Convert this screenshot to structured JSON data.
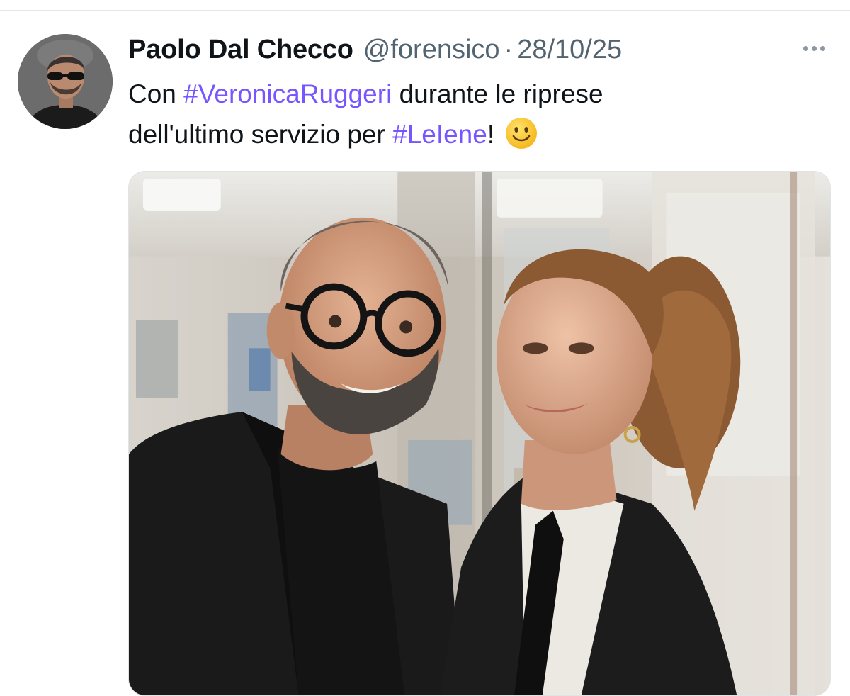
{
  "tweet": {
    "author": {
      "display_name": "Paolo Dal Checco",
      "handle": "@forensico",
      "avatar_icon": "profile-photo"
    },
    "separator": "·",
    "date": "28/10/25",
    "more_icon": "more-horizontal-icon",
    "text": {
      "part1": "Con ",
      "hashtag1": "#VeronicaRuggeri",
      "part2": " durante le riprese",
      "part3": "dell'ultimo servizio per ",
      "hashtag2": "#LeIene",
      "part4": "!",
      "emoji": "slightly-smiling-face"
    },
    "media": {
      "type": "photo"
    }
  },
  "colors": {
    "hashtag": "#7856ff",
    "text": "#0f1419",
    "secondary": "#536471"
  }
}
